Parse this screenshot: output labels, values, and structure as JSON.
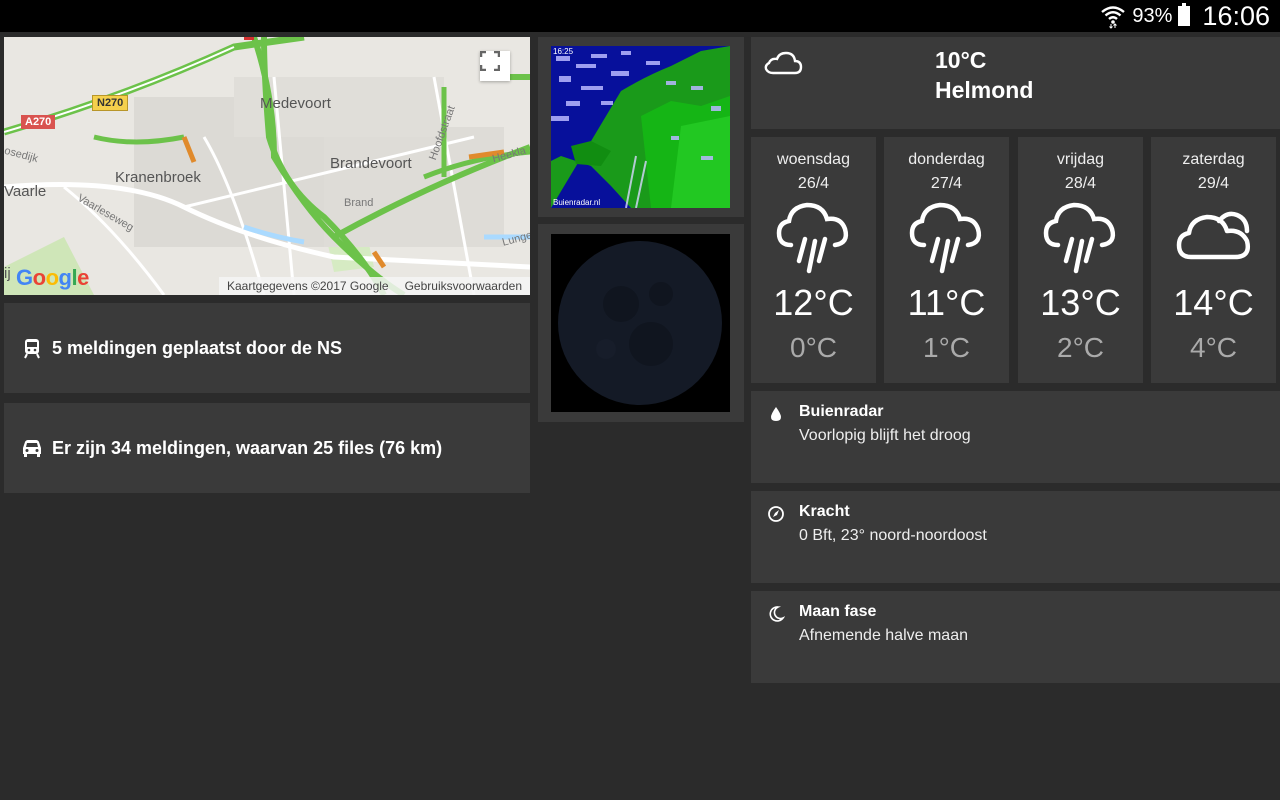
{
  "status_bar": {
    "battery_percent": "93%",
    "time": "16:06"
  },
  "map": {
    "labels": {
      "medevoort": "Medevoort",
      "kranenbroek": "Kranenbroek",
      "brandevoort": "Brandevoort",
      "vaarle": "Vaarle",
      "brand": "Brand",
      "vaarleseweg": "Vaarleseweg",
      "hoofdstraat": "Hoofdstraat",
      "heekla": "Heekla",
      "lunge": "Lunge",
      "hosedijk": "osedijk",
      "left_partial": "ij"
    },
    "shields": {
      "a270": "A270",
      "n270": "N270"
    },
    "attribution": "Kaartgegevens ©2017 Google",
    "terms": "Gebruiksvoorwaarden",
    "logo": "Google"
  },
  "notices": {
    "ns": "5 meldingen geplaatst door de NS",
    "traffic": "Er zijn 34 meldingen, waarvan 25 files (76 km)"
  },
  "radar": {
    "time": "16:25",
    "credit": "Buienradar.nl"
  },
  "current": {
    "temp": "10°C",
    "city": "Helmond",
    "icon": "cloud-icon"
  },
  "forecast": [
    {
      "day": "woensdag",
      "date": "26/4",
      "high": "12°C",
      "low": "0°C",
      "icon": "rain-icon"
    },
    {
      "day": "donderdag",
      "date": "27/4",
      "high": "11°C",
      "low": "1°C",
      "icon": "rain-icon"
    },
    {
      "day": "vrijdag",
      "date": "28/4",
      "high": "13°C",
      "low": "2°C",
      "icon": "rain-icon"
    },
    {
      "day": "zaterdag",
      "date": "29/4",
      "high": "14°C",
      "low": "4°C",
      "icon": "cloud-icon"
    }
  ],
  "info": {
    "rain": {
      "title": "Buienradar",
      "text": "Voorlopig blijft het droog"
    },
    "wind": {
      "title": "Kracht",
      "text": "0 Bft, 23° noord-noordoost"
    },
    "moon": {
      "title": "Maan fase",
      "text": "Afnemende halve maan"
    }
  }
}
